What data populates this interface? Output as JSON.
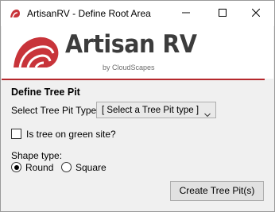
{
  "window": {
    "title": "ArtisanRV - Define Root Area",
    "controls": {
      "minimize": "minimize",
      "maximize": "maximize",
      "close": "close"
    }
  },
  "banner": {
    "brand": "Artisan RV",
    "byline": "by CloudScapes",
    "accent_color": "#b5282d"
  },
  "form": {
    "section_title": "Define Tree Pit",
    "tree_pit_type_label": "Select Tree Pit Type:",
    "tree_pit_type_value": "[ Select a Tree Pit type ]",
    "green_site_label": "Is tree on green site?",
    "green_site_checked": false,
    "shape_type_label": "Shape type:",
    "shape_options": [
      {
        "label": "Round",
        "selected": true
      },
      {
        "label": "Square",
        "selected": false
      }
    ],
    "create_button": "Create Tree Pit(s)"
  },
  "icons": [
    "app-icon",
    "minimize-icon",
    "maximize-icon",
    "close-icon",
    "artisan-logo-icon",
    "chevron-down-icon"
  ]
}
